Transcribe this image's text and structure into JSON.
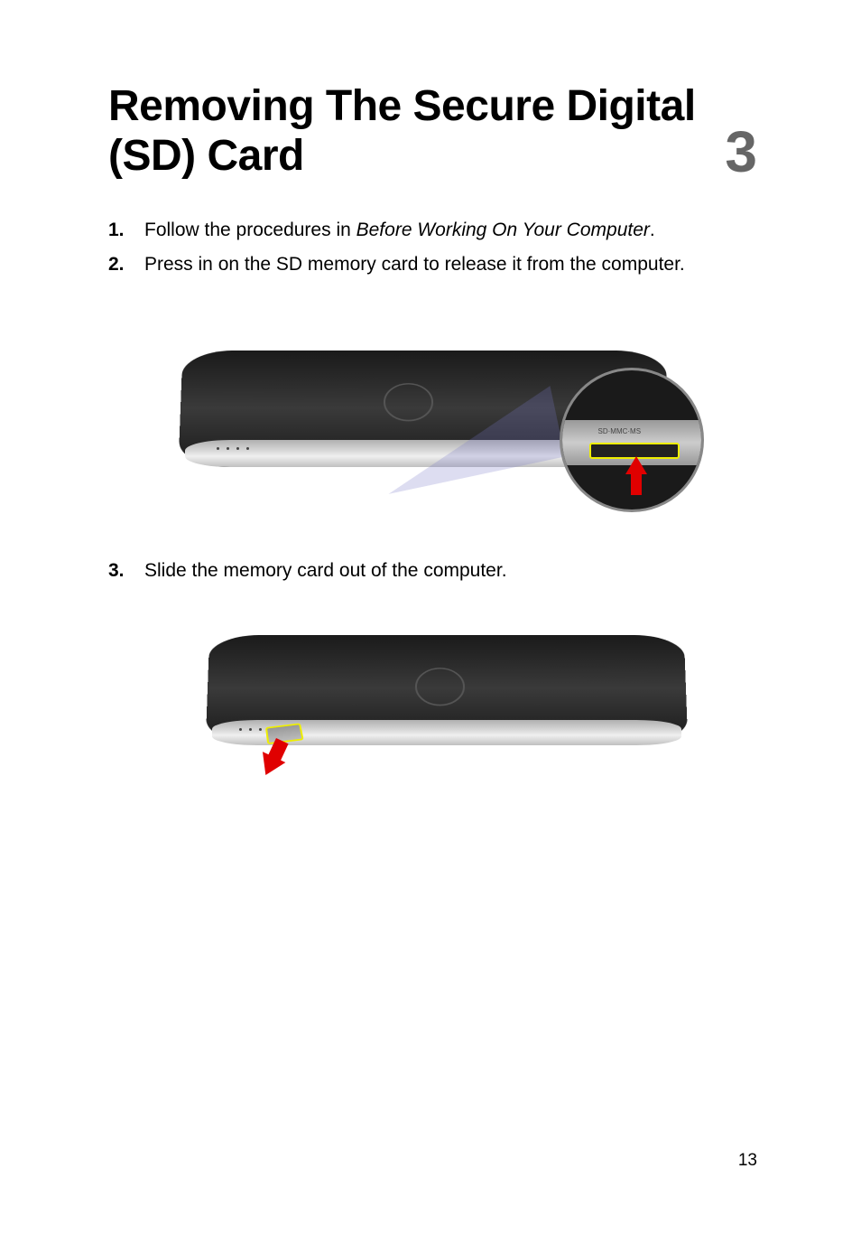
{
  "chapter": {
    "title": "Removing The Secure Digital (SD) Card",
    "number": "3"
  },
  "steps": [
    {
      "number": "1.",
      "prefix": "Follow the procedures in ",
      "italic": "Before Working On Your Computer",
      "suffix": "."
    },
    {
      "number": "2.",
      "text": "Press in on the SD memory card to release it from the computer."
    },
    {
      "number": "3.",
      "text": "Slide the memory card out of the computer."
    }
  ],
  "figure1": {
    "slot_label": "SD·MMC·MS"
  },
  "page_number": "13"
}
